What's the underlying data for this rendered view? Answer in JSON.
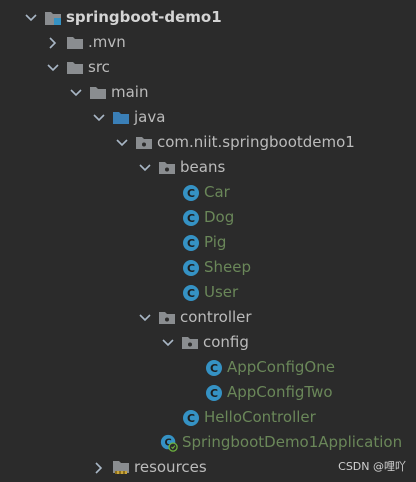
{
  "tree": {
    "root": "springboot-demo1",
    "mvn": ".mvn",
    "src": "src",
    "main": "main",
    "java": "java",
    "package": "com.niit.springbootdemo1",
    "beans": "beans",
    "beans_classes": [
      "Car",
      "Dog",
      "Pig",
      "Sheep",
      "User"
    ],
    "controller": "controller",
    "config": "config",
    "config_classes": [
      "AppConfigOne",
      "AppConfigTwo"
    ],
    "hello_controller": "HelloController",
    "application": "SpringbootDemo1Application",
    "resources": "resources"
  },
  "icons": {
    "class_icon": "class-c-icon",
    "folder_icon": "folder-icon",
    "package_icon": "package-folder-icon",
    "module_icon": "module-folder-icon",
    "source_root_icon": "source-root-folder-icon",
    "resources_icon": "resources-folder-icon",
    "application_icon": "spring-boot-application-icon"
  },
  "colors": {
    "background": "#2b2b2b",
    "text": "#bbbbbb",
    "class_text": "#6a8759",
    "class_icon": "#3592c4",
    "folder": "#8a8d90",
    "source_root": "#3a7fb7"
  },
  "watermark": "CSDN @哩吖"
}
